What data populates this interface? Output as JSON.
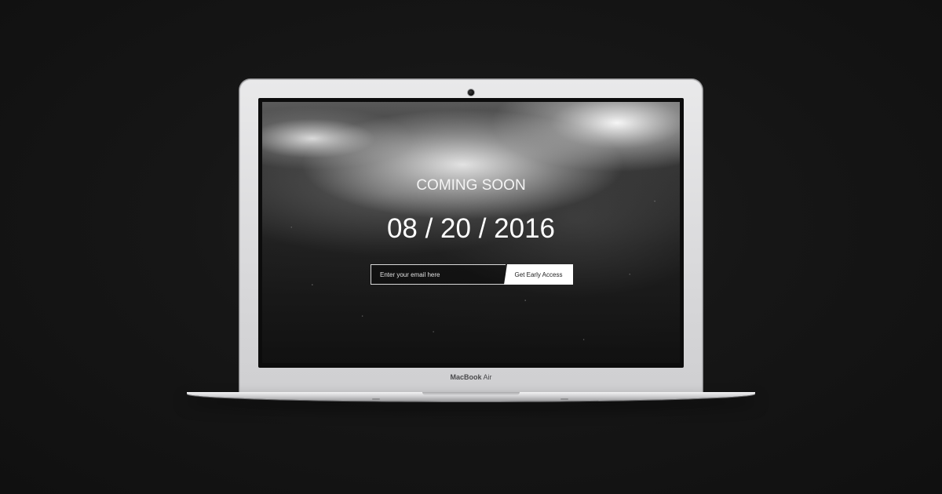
{
  "laptop": {
    "model_brand": "MacBook",
    "model_suffix": " Air"
  },
  "page": {
    "heading": "COMING SOON",
    "date": "08 / 20 / 2016",
    "signup": {
      "email_placeholder": "Enter your email here",
      "button_label": "Get Early Access"
    }
  },
  "colors": {
    "background": "#141414",
    "button_bg": "#ffffff",
    "heading_text": "#f4f4f4"
  }
}
